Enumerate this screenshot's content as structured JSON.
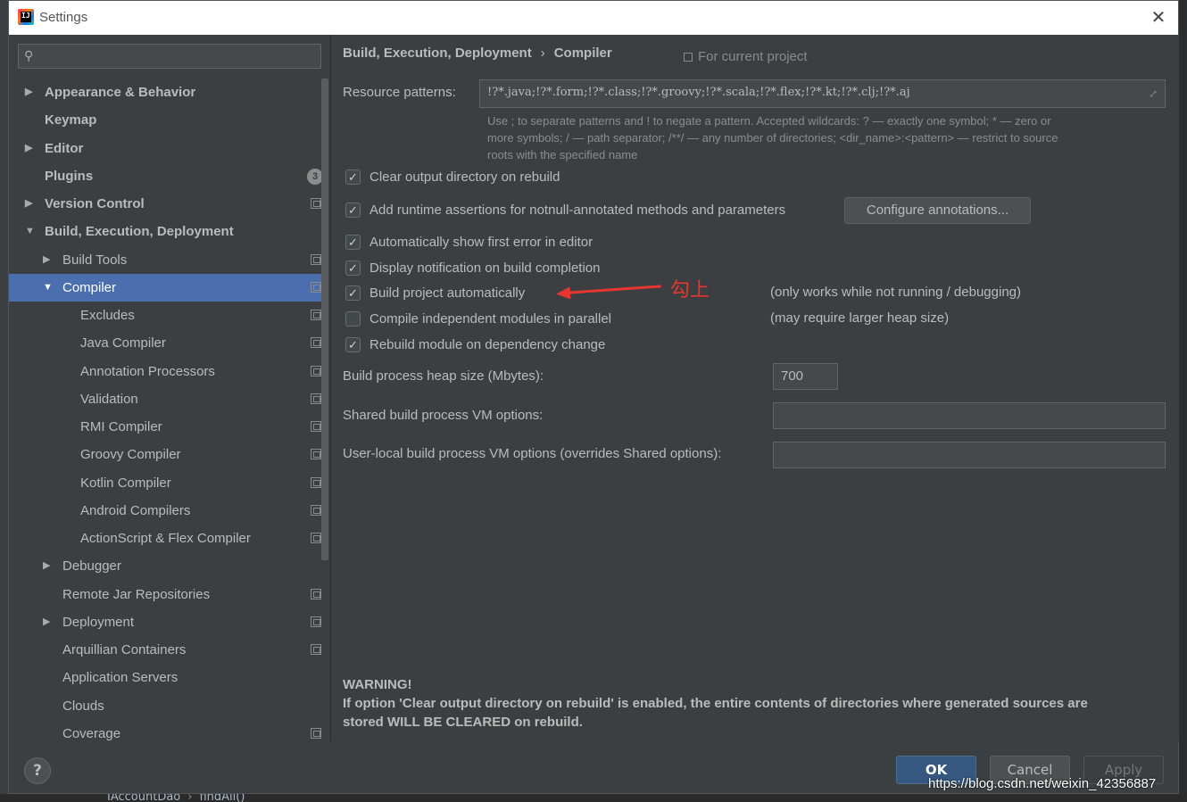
{
  "window": {
    "title": "Settings",
    "close_glyph": "✕"
  },
  "sidebar": {
    "search_placeholder": "",
    "items": [
      {
        "label": "Appearance & Behavior",
        "bold": true,
        "arrow": "▶",
        "level": 0
      },
      {
        "label": "Keymap",
        "bold": true,
        "arrow": "",
        "level": 0
      },
      {
        "label": "Editor",
        "bold": true,
        "arrow": "▶",
        "level": 0
      },
      {
        "label": "Plugins",
        "bold": true,
        "arrow": "",
        "level": 0,
        "badge": "3"
      },
      {
        "label": "Version Control",
        "bold": true,
        "arrow": "▶",
        "level": 0,
        "project": true
      },
      {
        "label": "Build, Execution, Deployment",
        "bold": true,
        "arrow": "▼",
        "level": 0
      },
      {
        "label": "Build Tools",
        "bold": false,
        "arrow": "▶",
        "level": 1,
        "project": true
      },
      {
        "label": "Compiler",
        "bold": false,
        "arrow": "▼",
        "level": 1,
        "project": true,
        "selected": true
      },
      {
        "label": "Excludes",
        "bold": false,
        "arrow": "",
        "level": 2,
        "project": true
      },
      {
        "label": "Java Compiler",
        "bold": false,
        "arrow": "",
        "level": 2,
        "project": true
      },
      {
        "label": "Annotation Processors",
        "bold": false,
        "arrow": "",
        "level": 2,
        "project": true
      },
      {
        "label": "Validation",
        "bold": false,
        "arrow": "",
        "level": 2,
        "project": true
      },
      {
        "label": "RMI Compiler",
        "bold": false,
        "arrow": "",
        "level": 2,
        "project": true
      },
      {
        "label": "Groovy Compiler",
        "bold": false,
        "arrow": "",
        "level": 2,
        "project": true
      },
      {
        "label": "Kotlin Compiler",
        "bold": false,
        "arrow": "",
        "level": 2,
        "project": true
      },
      {
        "label": "Android Compilers",
        "bold": false,
        "arrow": "",
        "level": 2,
        "project": true
      },
      {
        "label": "ActionScript & Flex Compiler",
        "bold": false,
        "arrow": "",
        "level": 2,
        "project": true
      },
      {
        "label": "Debugger",
        "bold": false,
        "arrow": "▶",
        "level": 1
      },
      {
        "label": "Remote Jar Repositories",
        "bold": false,
        "arrow": "",
        "level": 1,
        "project": true
      },
      {
        "label": "Deployment",
        "bold": false,
        "arrow": "▶",
        "level": 1,
        "project": true
      },
      {
        "label": "Arquillian Containers",
        "bold": false,
        "arrow": "",
        "level": 1,
        "project": true
      },
      {
        "label": "Application Servers",
        "bold": false,
        "arrow": "",
        "level": 1
      },
      {
        "label": "Clouds",
        "bold": false,
        "arrow": "",
        "level": 1
      },
      {
        "label": "Coverage",
        "bold": false,
        "arrow": "",
        "level": 1,
        "project": true
      }
    ]
  },
  "main": {
    "breadcrumb": {
      "parent": "Build, Execution, Deployment",
      "separator": "›",
      "current": "Compiler"
    },
    "for_project": "For current project",
    "resource_patterns_label": "Resource patterns:",
    "resource_patterns_value": "!?*.java;!?*.form;!?*.class;!?*.groovy;!?*.scala;!?*.flex;!?*.kt;!?*.clj;!?*.aj",
    "hint_line1": "Use ; to separate patterns and ! to negate a pattern. Accepted wildcards: ? — exactly one symbol; * — zero or",
    "hint_line2": "more symbols; / — path separator; /**/ — any number of directories; <dir_name>:<pattern> — restrict to source",
    "hint_line3": "roots with the specified name",
    "checkboxes": {
      "clear_output": {
        "label": "Clear output directory on rebuild",
        "checked": "✓"
      },
      "runtime_assertions": {
        "label": "Add runtime assertions for notnull-annotated methods and parameters",
        "checked": "✓"
      },
      "show_first_error": {
        "label": "Automatically show first error in editor",
        "checked": "✓"
      },
      "notify_build": {
        "label": "Display notification on build completion",
        "checked": "✓"
      },
      "build_auto": {
        "label": "Build project automatically",
        "checked": "✓"
      },
      "compile_parallel": {
        "label": "Compile independent modules in parallel",
        "checked": ""
      },
      "rebuild_module": {
        "label": "Rebuild module on dependency change",
        "checked": "✓"
      }
    },
    "configure_annotations_label": "Configure annotations...",
    "note_build_auto": "(only works while not running / debugging)",
    "note_parallel": "(may require larger heap size)",
    "annotation_text": "勾上",
    "heap_label": "Build process heap size (Mbytes):",
    "heap_value": "700",
    "shared_vm_label": "Shared build process VM options:",
    "shared_vm_value": "",
    "user_vm_label": "User-local build process VM options (overrides Shared options):",
    "user_vm_value": "",
    "warning_title": "WARNING!",
    "warning_line1": "If option 'Clear output directory on rebuild' is enabled, the entire contents of directories where generated sources are",
    "warning_line2": "stored WILL BE CLEARED on rebuild."
  },
  "footer": {
    "help_label": "?",
    "ok_label": "OK",
    "cancel_label": "Cancel",
    "apply_label": "Apply"
  },
  "background": {
    "crumb_a": "IAccountDao",
    "crumb_sep": "›",
    "crumb_b": "findAll()"
  },
  "watermark": "https://blog.csdn.net/weixin_42356887",
  "colors": {
    "selection": "#4b6eaf",
    "ok_button": "#365880",
    "annotation": "#e8352f"
  }
}
